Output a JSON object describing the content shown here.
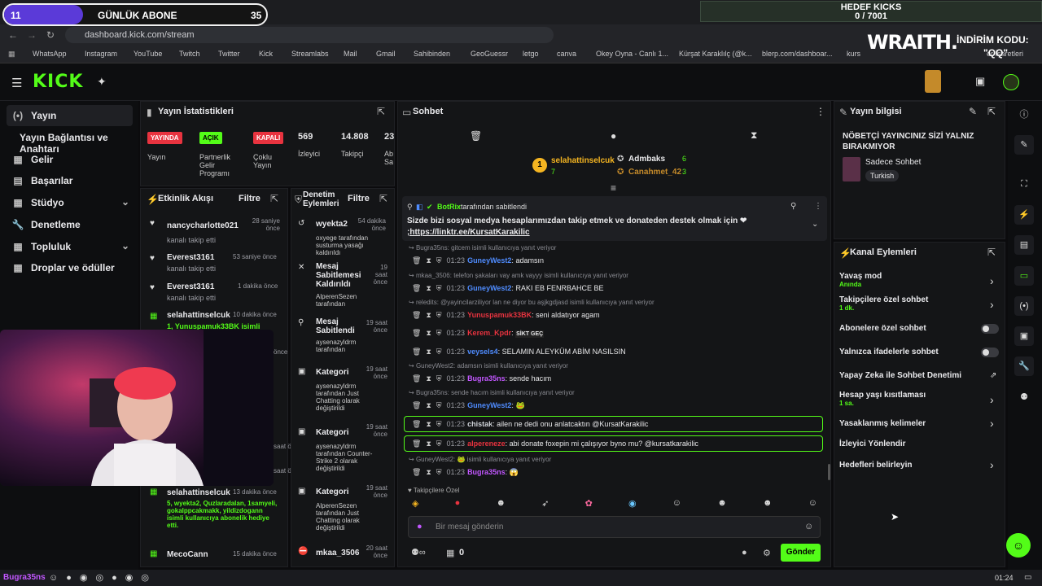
{
  "overlay": {
    "sub_count": "11",
    "sub_label": "GÜNLÜK ABONE",
    "sub_goal": "35",
    "kick_goal_title": "HEDEF KICKS",
    "kick_goal_value": "0 / 7001",
    "sponsor": "WRAITH.",
    "discount_label": "İNDİRİM KODU:",
    "discount_code": "\"QQ\""
  },
  "browser": {
    "tab_fragment": "ashboard",
    "url": "dashboard.kick.com/stream",
    "bookmarks": [
      "WhatsApp",
      "Instagram",
      "YouTube",
      "Twitch",
      "Twitter",
      "Kick",
      "Streamlabs",
      "Mail",
      "Gmail",
      "Sahibinden",
      "GeoGuessr",
      "letgo",
      "canva",
      "Okey Oyna - Canlı 1...",
      "Kürşat Karaklılç (@k...",
      "blerp.com/dashboar...",
      "kurs"
    ],
    "bookmarks_end": "er İşaretleri"
  },
  "sidebar": {
    "items": [
      {
        "label": "Yayın",
        "icon": "(•)"
      },
      {
        "label": "Yayın Bağlantısı ve Anahtarı",
        "icon": ""
      },
      {
        "label": "Gelir",
        "icon": "▦"
      },
      {
        "label": "Başarılar",
        "icon": "▤"
      },
      {
        "label": "Stüdyo",
        "icon": "▦"
      },
      {
        "label": "Denetleme",
        "icon": "🔧"
      },
      {
        "label": "Topluluk",
        "icon": "▦"
      },
      {
        "label": "Droplar ve ödüller",
        "icon": "▦"
      }
    ]
  },
  "stats": {
    "title": "Yayın İstatistikleri",
    "cols": [
      {
        "badge": "YAYINDA",
        "label": "Yayın"
      },
      {
        "badge": "AÇIK",
        "label": "Partnerlik Gelir Programı"
      },
      {
        "badge": "KAPALI",
        "label": "Çoklu Yayın"
      },
      {
        "value": "569",
        "label": "İzleyici"
      },
      {
        "value": "14.808",
        "label": "Takipçi"
      },
      {
        "value": "23",
        "label": "Ab Sa"
      }
    ]
  },
  "activity": {
    "title": "Etkinlik Akışı",
    "filter": "Filtre",
    "events": [
      {
        "user": "nancycharlotte021",
        "desc": "kanalı takip etti",
        "time": "28 saniye önce"
      },
      {
        "user": "Everest3161",
        "desc": "kanalı takip etti",
        "time": "53 saniye önce"
      },
      {
        "user": "Everest3161",
        "desc": "kanalı takip etti",
        "time": "1 dakika önce"
      },
      {
        "user": "selahattinselcuk",
        "desc": "1, Yunuspamuk33BK isimli",
        "time": "10 dakika önce"
      },
      {
        "user": "selahattinselcuk",
        "desc": "5, wyekta2, Quzlaradalan, 1samyeli, gokalppcakmakk, yildizdogann isimli kullanıcıya abonelik hediye etti.",
        "time": "13 dakika önce"
      },
      {
        "user": "MecoCann",
        "desc": "",
        "time": "15 dakika önce"
      }
    ],
    "partial_times": [
      "önce",
      "saat önce",
      "saat önce"
    ]
  },
  "mod": {
    "title": "Denetim Eylemleri",
    "filter": "Filtre",
    "items": [
      {
        "title": "wyekta2",
        "desc": "oxyege tarafından susturma yasağı kaldırıldı",
        "time": "54 dakika önce",
        "icon": "↺"
      },
      {
        "title": "Mesaj Sabitlemesi Kaldırıldı",
        "desc": "AlperenSezen tarafından",
        "time": "19 saat önce",
        "icon": "✕"
      },
      {
        "title": "Mesaj Sabitlendi",
        "desc": "aysenazyldrm tarafından",
        "time": "19 saat önce",
        "icon": "⚲"
      },
      {
        "title": "Kategori",
        "desc": "aysenazyldrm tarafından Just Chatting olarak değiştirildi",
        "time": "19 saat önce",
        "icon": "▣"
      },
      {
        "title": "Kategori",
        "desc": "aysenazyldrm tarafından Counter-Strike 2 olarak değiştirildi",
        "time": "19 saat önce",
        "icon": "▣"
      },
      {
        "title": "Kategori",
        "desc": "AlperenSezen tarafından Just Chatting olarak değiştirildi",
        "time": "19 saat önce",
        "icon": "▣"
      },
      {
        "title": "mkaa_3506",
        "desc": "",
        "time": "20 saat önce",
        "icon": "⛔"
      }
    ]
  },
  "chat": {
    "title": "Sohbet",
    "leaders": [
      {
        "name": "selahattinselcuk",
        "count": "7",
        "rank": "1"
      },
      {
        "name": "Admbaks",
        "count": "6"
      },
      {
        "name": "Canahmet_42",
        "count": "3"
      }
    ],
    "pinned": {
      "by": "BotRix",
      "by_suffix": "tarafından sabitlendi",
      "text": "Sizde bizi sosyal medya hesaplarımızdan takip etmek ve donateden destek olmak için ❤",
      "link": ";https://linktr.ee/KursatKarakilic"
    },
    "messages": [
      {
        "reply": "Bugra35ns: gitcem isimli kullanıcıya yanıt veriyor",
        "time": "01:23",
        "user": "GuneyWest2",
        "color": "#4f8cff",
        "text": "adamsın"
      },
      {
        "reply": "mkaa_3506: telefon şakaları vay amk vayyy isimli kullanıcıya yanıt veriyor",
        "time": "01:23",
        "user": "GuneyWest2",
        "color": "#4f8cff",
        "text": "RAKI EB FENRBAHCE BE"
      },
      {
        "reply": "reledits: @yayincilarziliyor lan ne diyor bu aşjkgdjasd isimli kullanıcıya yanıt veriyor",
        "time": "01:23",
        "user": "Yunuspamuk33BK",
        "color": "#e8333f",
        "text": "seni aldatıyor agam"
      },
      {
        "reply": "",
        "time": "01:23",
        "user": "Kerem_Kpdr",
        "color": "#e8333f",
        "text": "SİKT GEÇ"
      },
      {
        "reply": "",
        "time": "01:23",
        "user": "veysels4",
        "color": "#4f8cff",
        "text": "SELAMIN ALEYKÜM ABİM NASILSIN"
      },
      {
        "reply": "GuneyWest2: adamsın isimli kullanıcıya yanıt veriyor",
        "time": "01:23",
        "user": "Bugra35ns",
        "color": "#c257ff",
        "text": "sende hacım"
      },
      {
        "reply": "Bugra35ns: sende hacım isimli kullanıcıya yanıt veriyor",
        "time": "01:23",
        "user": "GuneyWest2",
        "color": "#4f8cff",
        "text": "🐸"
      },
      {
        "reply": "",
        "time": "01:23",
        "user": "chistak",
        "color": "#cfd3d8",
        "text": "ailen ne dedi onu anlatcaktın @KursatKarakilic"
      },
      {
        "reply": "",
        "time": "01:23",
        "user": "alpereneze",
        "color": "#e8333f",
        "text": "abi donate foxepin mi çalışıyor byno mu? @kursatkarakilic"
      },
      {
        "reply": "GuneyWest2: 🐸 isimli kullanıcıya yanıt veriyor",
        "time": "01:23",
        "user": "Bugra35ns",
        "color": "#c257ff",
        "text": "😱"
      }
    ],
    "followers_only": "Takipçilere Özel",
    "input_placeholder": "Bir mesaj gönderin",
    "points": "0",
    "send": "Gönder"
  },
  "info": {
    "title": "Yayın bilgisi",
    "stream_title": "NÖBETÇİ YAYINCINIZ SİZİ YALNIZ BIRAKMIYOR",
    "category": "Sadece Sohbet",
    "tag": "Turkish"
  },
  "actions": {
    "title": "Kanal Eylemleri",
    "items": [
      {
        "label": "Yavaş mod",
        "sub": "Anında"
      },
      {
        "label": "Takipçilere özel sohbet",
        "sub": "1 dk."
      },
      {
        "label": "Abonelere özel sohbet",
        "sub": ""
      },
      {
        "label": "Yalnızca ifadelerle sohbet",
        "sub": ""
      },
      {
        "label": "Yapay Zeka ile Sohbet Denetimi",
        "sub": ""
      },
      {
        "label": "Hesap yaşı kısıtlaması",
        "sub": "1 sa."
      },
      {
        "label": "Yasaklanmış kelimeler",
        "sub": ""
      },
      {
        "label": "İzleyici Yönlendir",
        "sub": ""
      },
      {
        "label": "Hedefleri belirleyin",
        "sub": ""
      }
    ]
  },
  "taskbar": {
    "user": "Bugra35ns",
    "clock": "01:24"
  }
}
